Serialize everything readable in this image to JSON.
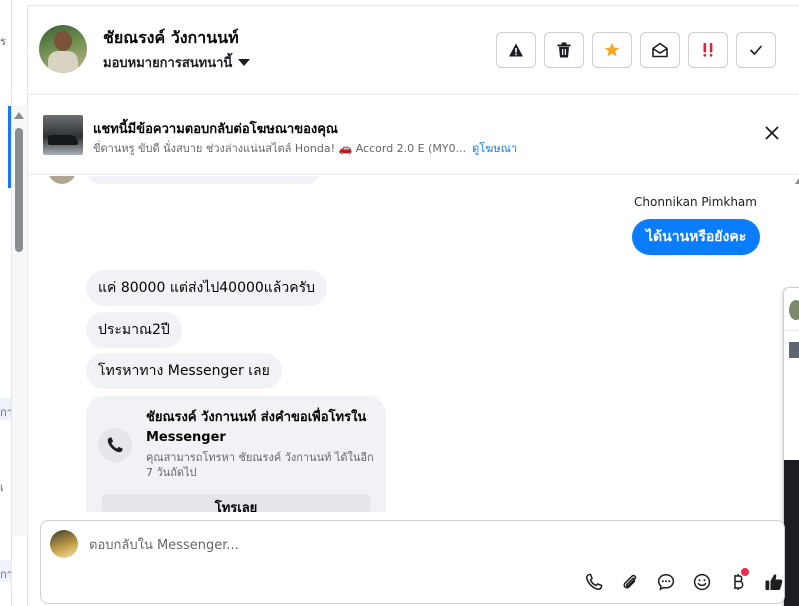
{
  "left_strip": {
    "fragments": [
      "ร",
      "ๆ",
      "กา",
      "เ",
      "กา"
    ]
  },
  "header": {
    "contact_name": "ชัยณรงค์ วังกานนท์",
    "assign_label": "มอบหมายการสนทนานี้",
    "actions": [
      {
        "name": "report-spam",
        "icon": "warning-triangle-icon"
      },
      {
        "name": "delete",
        "icon": "trash-icon"
      },
      {
        "name": "star",
        "icon": "star-icon",
        "color": "#f5a623"
      },
      {
        "name": "mark-unread",
        "icon": "open-envelope-icon"
      },
      {
        "name": "follow-up",
        "icon": "double-exclamation-icon",
        "color": "#e41e3f"
      },
      {
        "name": "mark-done",
        "icon": "checkmark-icon"
      }
    ]
  },
  "ad_banner": {
    "title": "แชทนี้มีข้อความตอบกลับต่อโฆษณาของคุณ",
    "subtitle": "ขี่ดานหรู ขับดี นั่งสบาย ช่วงล่างแน่นสไตล์ Honda! 🚗  Accord 2.0 E (MY0...",
    "link": "ดูโฆษณา"
  },
  "conversation": {
    "outgoing": {
      "sender": "Chonnikan Pimkham",
      "text": "ได้นานหรือยังคะ"
    },
    "incoming": [
      "แค่ 80000 แต่ส่งไป40000แล้วครับ",
      "ประมาณ2ปี",
      "โทรหาทาง Messenger เลย"
    ],
    "call_card": {
      "title": "ชัยณรงค์ วังกานนท์ ส่งคำขอเพื่อโทรใน Messenger",
      "subtitle": "คุณสามารถโทรหา ชัยณรงค์ วังกานนท์ ได้ในอีก 7 วันถัดไป",
      "button": "โทรเลย"
    }
  },
  "composer": {
    "placeholder": "ตอบกลับใน Messenger...",
    "tools": [
      "phone-icon",
      "paperclip-icon",
      "chat-bubble-icon",
      "emoji-icon",
      "baht-icon",
      "thumbs-up-icon"
    ]
  }
}
